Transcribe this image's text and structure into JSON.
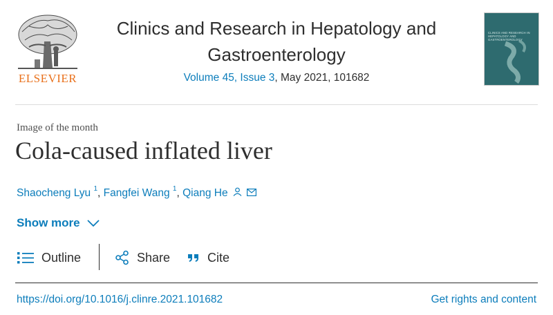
{
  "publisher": {
    "logo_text": "ELSEVIER"
  },
  "journal": {
    "title": "Clinics and Research in Hepatology and Gastroenterology",
    "volume_issue": "Volume 45, Issue 3",
    "issue_details": ", May 2021, 101682",
    "cover_text": "CLINICS AND RESEARCH IN HEPATOLOGY AND GASTROENTEROLOGY"
  },
  "article": {
    "type": "Image of the month",
    "title": "Cola-caused inflated liver",
    "authors": [
      {
        "name": "Shaocheng Lyu",
        "affil": "1"
      },
      {
        "name": "Fangfei Wang",
        "affil": "1"
      },
      {
        "name": "Qiang He",
        "affil": ""
      }
    ],
    "show_more": "Show more"
  },
  "toolbar": {
    "outline": "Outline",
    "share": "Share",
    "cite": "Cite"
  },
  "footer": {
    "doi": "https://doi.org/10.1016/j.clinre.2021.101682",
    "rights": "Get rights and content"
  },
  "colors": {
    "link": "#0c7dbb",
    "publisher_orange": "#e9711c",
    "cover": "#2e6b6f"
  },
  "icons": [
    "elsevier-tree-logo",
    "person-icon",
    "envelope-icon",
    "chevron-down-icon",
    "list-icon",
    "share-icon",
    "quote-icon"
  ]
}
